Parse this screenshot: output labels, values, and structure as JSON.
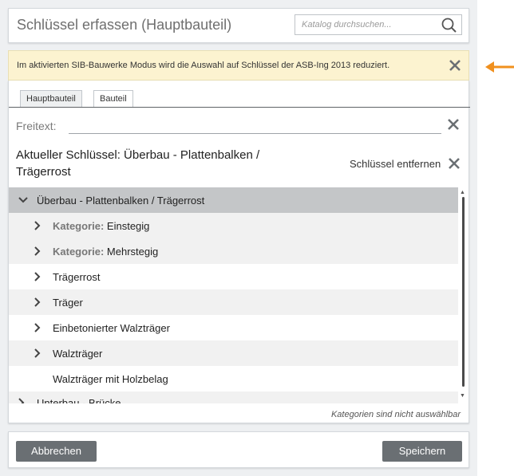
{
  "header": {
    "title": "Schlüssel erfassen (Hauptbauteil)",
    "search_placeholder": "Katalog durchsuchen..."
  },
  "banner": {
    "text": "Im aktivierten SIB-Bauwerke Modus wird die Auswahl auf Schlüssel der ASB-Ing 2013 reduziert."
  },
  "tabs": [
    {
      "label": "Hauptbauteil",
      "active": true
    },
    {
      "label": "Bauteil",
      "active": false
    }
  ],
  "freetext": {
    "label": "Freitext:",
    "value": ""
  },
  "current_key": {
    "text": "Aktueller Schlüssel: Überbau - Plattenbalken / Trägerrost",
    "remove_label": "Schlüssel entfernen"
  },
  "tree": {
    "root": {
      "label": "Überbau - Plattenbalken / Trägerrost",
      "expanded": true
    },
    "items": [
      {
        "prefix": "Kategorie:",
        "label": "Einstegig",
        "expandable": true
      },
      {
        "prefix": "Kategorie:",
        "label": "Mehrstegig",
        "expandable": true
      },
      {
        "prefix": "",
        "label": "Trägerrost",
        "expandable": true
      },
      {
        "prefix": "",
        "label": "Träger",
        "expandable": true
      },
      {
        "prefix": "",
        "label": "Einbetonierter Walzträger",
        "expandable": true
      },
      {
        "prefix": "",
        "label": "Walzträger",
        "expandable": true
      },
      {
        "prefix": "",
        "label": "Walzträger mit Holzbelag",
        "expandable": false
      }
    ],
    "next_root": {
      "label": "Unterbau - Brücke",
      "expanded": false
    }
  },
  "footer_note": "Kategorien sind nicht auswählbar",
  "buttons": {
    "cancel": "Abbrechen",
    "save": "Speichern"
  },
  "colors": {
    "banner_bg": "#fcf3d0",
    "arrow": "#f0901e",
    "button": "#6a6f73",
    "tree_root_bg": "#c4c6c8"
  },
  "icons": {
    "search": "search-icon",
    "close": "close-icon",
    "chevron_down": "chevron-down-icon",
    "chevron_right": "chevron-right-icon"
  }
}
